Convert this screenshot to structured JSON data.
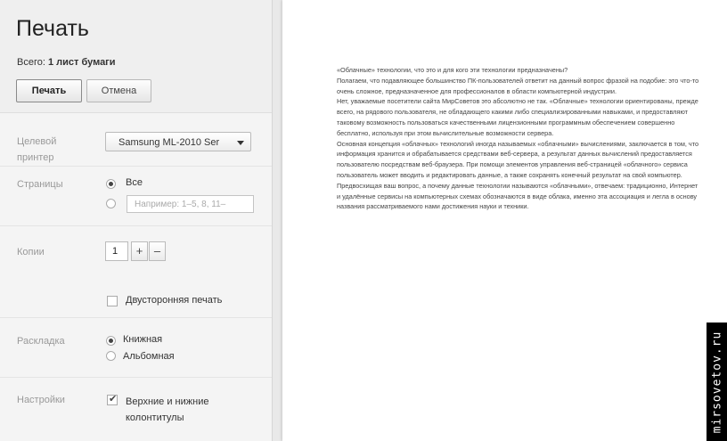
{
  "sidebar": {
    "title": "Печать",
    "total_prefix": "Всего:",
    "total_value": "1 лист бумаги",
    "print_button": "Печать",
    "cancel_button": "Отмена",
    "printer": {
      "label_line1": "Целевой",
      "label_line2": "принтер",
      "selected": "Samsung ML-2010 Ser"
    },
    "pages": {
      "label": "Страницы",
      "all_option": "Все",
      "range_placeholder": "Например: 1–5, 8, 11–"
    },
    "copies": {
      "label": "Копии",
      "value": "1",
      "plus": "+",
      "minus": "–"
    },
    "duplex": {
      "label": "Двусторонняя печать",
      "checked": false
    },
    "layout": {
      "label": "Раскладка",
      "portrait": "Книжная",
      "landscape": "Альбомная",
      "selected": "portrait"
    },
    "settings": {
      "label": "Настройки",
      "option_line1": "Верхние и нижние",
      "option_line2": "колонтитулы",
      "checked": true
    }
  },
  "preview": {
    "paragraphs": [
      "«Облачные» технологии, что это и для кого эти технологии предназначены?",
      "Полагаем, что подавляющее большинство ПК-пользователей ответит на данный вопрос фразой на подобие: это что-то очень сложное, предназначенное для профессионалов в области компьютерной индустрии.",
      "Нет, уважаемые посетители сайта МирСоветов это абсолютно не так. «Облачные» технологии ориентированы, прежде всего, на рядового пользователя, не обладающего какими либо специализированными навыками, и предоставляют таковому возможность пользоваться качественными лицензионными программным обеспечением совершенно бесплатно, используя при этом вычислительные возможности сервера.",
      "Основная концепция «облачных» технологий иногда называемых «облачными» вычислениями, заключается в том, что информация хранится и обрабатывается средствами веб-сервера, а результат данных вычислений предоставляется пользователю посредствам веб-браузера. При помощи элементов управления веб-страницей «облачного» сервиса пользователь может вводить и редактировать данные, а также сохранять конечный результат на свой компьютер.",
      "Предвосхищая ваш вопрос, а почему данные технологии называются «облачными», отвечаем: традиционно, Интернет и удалённые сервисы на компьютерных схемах обозначаются в виде облака, именно эта ассоциация и легла в основу названия рассматриваемого нами достижения науки и техники."
    ]
  },
  "watermark": "mirsovetov.ru"
}
